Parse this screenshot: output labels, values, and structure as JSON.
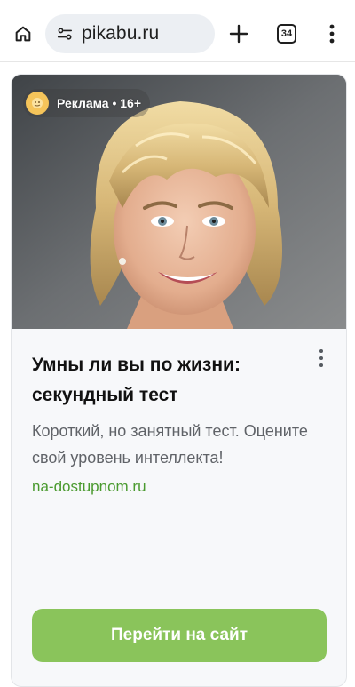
{
  "browser": {
    "url": "pikabu.ru",
    "tab_count": "34",
    "icons": {
      "home": "home-icon",
      "site_settings": "tune-icon",
      "new_tab": "plus-icon",
      "tabs": "tab-switcher-icon",
      "menu": "more-vert-icon"
    }
  },
  "ad": {
    "badge": "Реклама • 16+",
    "badge_icon": "sponsor-avatar-icon",
    "title": "Умны ли вы по жизни: секундный тест",
    "description": "Короткий, но занятный тест. Оцените свой уровень интеллекта!",
    "domain": "na-dostupnom.ru",
    "cta_label": "Перейти на сайт",
    "colors": {
      "accent": "#8ac45b",
      "domain": "#4a9a2f"
    }
  }
}
